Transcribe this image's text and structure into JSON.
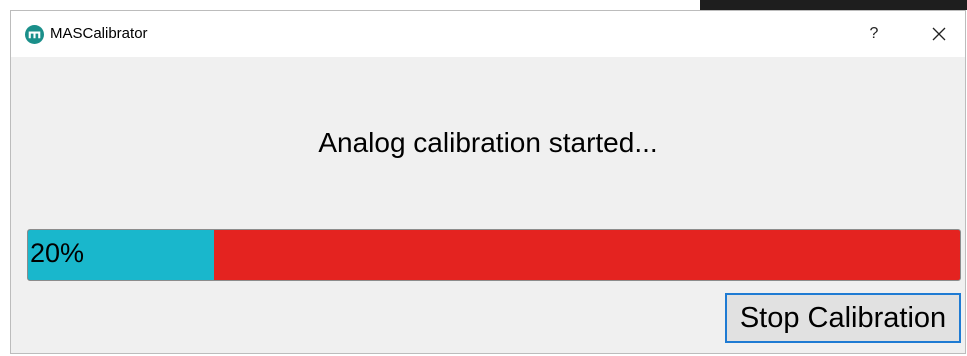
{
  "window": {
    "title": "MASCalibrator",
    "icon": "mascalibrator-app-icon",
    "help_label": "?",
    "close_icon": "close-icon"
  },
  "dialog": {
    "message": "Analog calibration started...",
    "progress": {
      "value_percent": 20,
      "label": "20%",
      "fill_color": "#19b7cc",
      "track_color": "#e42320"
    },
    "stop_button_label": "Stop Calibration"
  },
  "colors": {
    "button_focus_border": "#1f7bd3",
    "window_background": "#f0f0f0"
  }
}
